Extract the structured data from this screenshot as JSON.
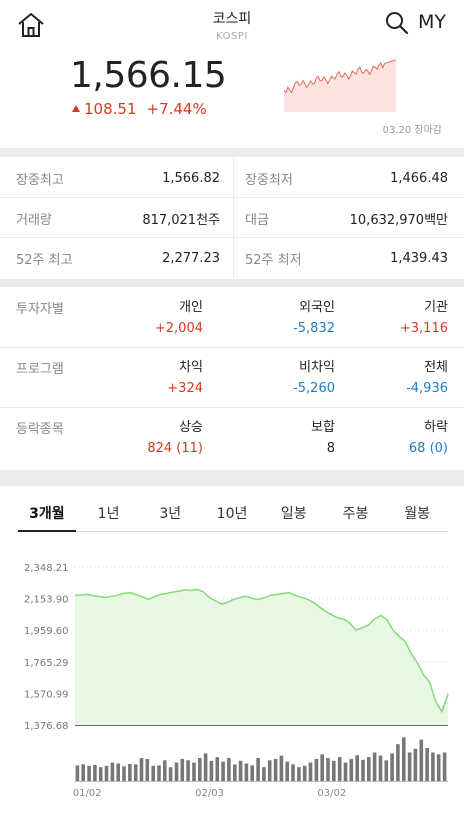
{
  "header": {
    "title": "코스피",
    "subtitle": "KOSPI",
    "home_icon": "home-icon",
    "search_icon": "search-icon",
    "my_label": "MY"
  },
  "quote": {
    "price": "1,566.15",
    "change": "108.51",
    "change_pct": "+7.44%",
    "direction": "up",
    "close_label": "03.20 장마감",
    "up_color": "#d63a20",
    "down_color": "#1f7ec4"
  },
  "stats": [
    {
      "left_label": "장중최고",
      "left_value": "1,566.82",
      "right_label": "장중최저",
      "right_value": "1,466.48"
    },
    {
      "left_label": "거래량",
      "left_value": "817,021천주",
      "right_label": "대금",
      "right_value": "10,632,970백만"
    },
    {
      "left_label": "52주 최고",
      "left_value": "2,277.23",
      "right_label": "52주 최저",
      "right_value": "1,439.43"
    }
  ],
  "flows": [
    {
      "label": "투자자별",
      "cols": [
        {
          "h": "개인",
          "v": "+2,004",
          "dir": "up"
        },
        {
          "h": "외국인",
          "v": "-5,832",
          "dir": "down"
        },
        {
          "h": "기관",
          "v": "+3,116",
          "dir": "up"
        }
      ]
    },
    {
      "label": "프로그램",
      "cols": [
        {
          "h": "차익",
          "v": "+324",
          "dir": "up"
        },
        {
          "h": "비차익",
          "v": "-5,260",
          "dir": "down"
        },
        {
          "h": "전체",
          "v": "-4,936",
          "dir": "down"
        }
      ]
    },
    {
      "label": "등락종목",
      "cols": [
        {
          "h": "상승",
          "v": "824 (11)",
          "dir": "up"
        },
        {
          "h": "보합",
          "v": "8",
          "dir": "flat"
        },
        {
          "h": "하락",
          "v": "68 (0)",
          "dir": "down"
        }
      ]
    }
  ],
  "tabs": [
    "3개월",
    "1년",
    "3년",
    "10년",
    "일봉",
    "주봉",
    "월봉"
  ],
  "active_tab": 0,
  "chart_data": {
    "type": "area",
    "y_ticks": [
      "2,348.21",
      "2,153.90",
      "1,959.60",
      "1,765.29",
      "1,570.99",
      "1,376.68"
    ],
    "ylim": [
      1376.68,
      2348.21
    ],
    "x_ticks": [
      "01/02",
      "02/03",
      "03/02"
    ],
    "x_tick_index": [
      2,
      22,
      42
    ],
    "line_color": "#86d97a",
    "fill_color": "#e8f9e3",
    "volume_color": "#777777",
    "values": [
      2175,
      2176,
      2180,
      2172,
      2166,
      2160,
      2168,
      2175,
      2186,
      2190,
      2178,
      2165,
      2150,
      2165,
      2180,
      2186,
      2194,
      2200,
      2208,
      2204,
      2210,
      2195,
      2160,
      2140,
      2120,
      2132,
      2150,
      2160,
      2168,
      2155,
      2148,
      2160,
      2175,
      2180,
      2185,
      2190,
      2175,
      2162,
      2150,
      2130,
      2102,
      2075,
      2054,
      2035,
      2028,
      2000,
      1960,
      1975,
      1992,
      2030,
      2050,
      2025,
      1960,
      1922,
      1890,
      1815,
      1758,
      1686,
      1640,
      1520,
      1458,
      1566
    ],
    "volumes": [
      0.34,
      0.36,
      0.33,
      0.35,
      0.3,
      0.33,
      0.4,
      0.38,
      0.32,
      0.37,
      0.36,
      0.5,
      0.48,
      0.33,
      0.34,
      0.45,
      0.3,
      0.4,
      0.48,
      0.45,
      0.4,
      0.5,
      0.6,
      0.44,
      0.52,
      0.42,
      0.5,
      0.36,
      0.44,
      0.38,
      0.34,
      0.5,
      0.3,
      0.45,
      0.48,
      0.55,
      0.42,
      0.36,
      0.3,
      0.33,
      0.4,
      0.48,
      0.58,
      0.5,
      0.44,
      0.52,
      0.4,
      0.48,
      0.56,
      0.46,
      0.52,
      0.62,
      0.55,
      0.45,
      0.6,
      0.8,
      0.95,
      0.62,
      0.7,
      0.9,
      0.72,
      0.62,
      0.58,
      0.62
    ]
  }
}
